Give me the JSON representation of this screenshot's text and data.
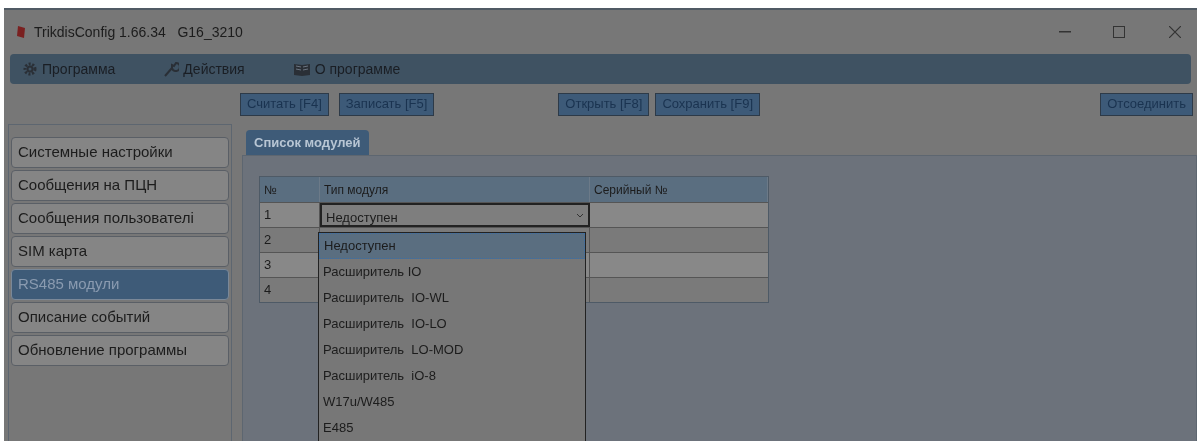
{
  "window": {
    "title": "TrikdisConfig 1.66.34   G16_3210"
  },
  "menu": [
    {
      "label": "Программа"
    },
    {
      "label": "Действия"
    },
    {
      "label": "О программе"
    }
  ],
  "toolbar": {
    "left": [
      "Считать [F4]",
      "Записать [F5]"
    ],
    "middle": [
      "Открыть [F8]",
      "Сохранить [F9]"
    ],
    "right": [
      "Отсоединить"
    ]
  },
  "sidebar": {
    "items": [
      {
        "label": "Системные настройки",
        "selected": false
      },
      {
        "label": "Сообщения на ПЦН",
        "selected": false
      },
      {
        "label": "Сообщения пользователі",
        "selected": false
      },
      {
        "label": "SIM карта",
        "selected": false
      },
      {
        "label": "RS485 модули",
        "selected": true
      },
      {
        "label": "Описание событий",
        "selected": false
      },
      {
        "label": "Обновление программы",
        "selected": false
      }
    ]
  },
  "tabs": [
    {
      "label": "Список модулей",
      "selected": true
    }
  ],
  "table": {
    "columns": [
      "№",
      "Тип модуля",
      "Серийный №"
    ],
    "rows": [
      {
        "number": "1",
        "type": "Недоступен"
      },
      {
        "number": "2"
      },
      {
        "number": "3"
      },
      {
        "number": "4"
      }
    ]
  },
  "dropdown": {
    "expanded": true,
    "options": [
      {
        "label": "Недоступен",
        "selected": true
      },
      {
        "label": "Расширитель IO",
        "selected": false
      },
      {
        "label": "Расширитель  IO-WL",
        "selected": false
      },
      {
        "label": "Расширитель  IO-LO",
        "selected": false
      },
      {
        "label": "Расширитель  LO-MOD",
        "selected": false
      },
      {
        "label": "Расширитель  iO-8",
        "selected": false
      },
      {
        "label": "W17u/W485",
        "selected": false
      },
      {
        "label": "E485",
        "selected": false
      }
    ]
  }
}
